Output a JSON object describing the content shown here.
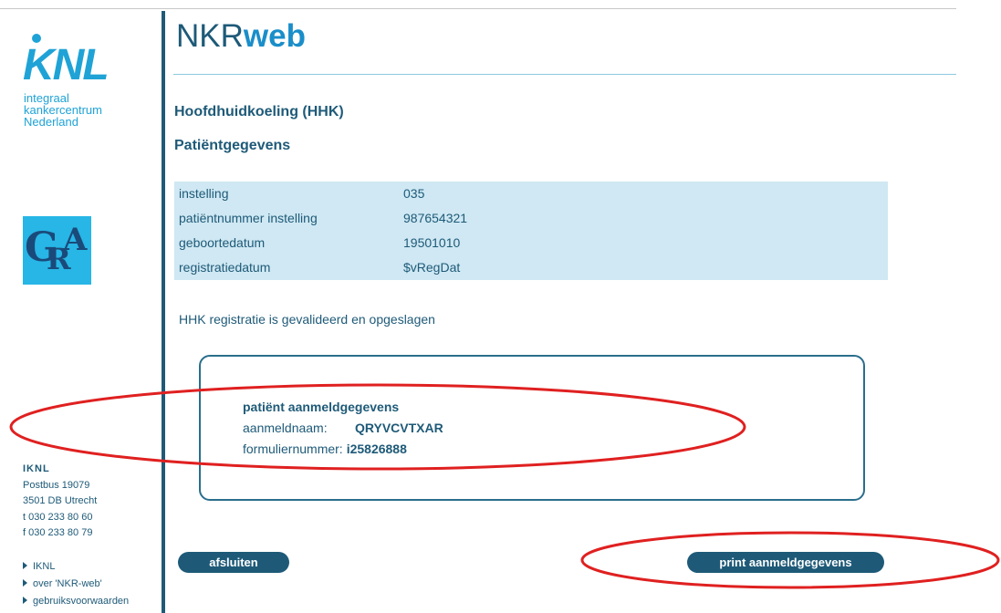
{
  "sidebar": {
    "logo_word": "KNL",
    "logo_sub": [
      "integraal",
      "kankercentrum",
      "Nederland"
    ],
    "badge": {
      "g": "G",
      "r": "R",
      "a": "A"
    },
    "address": {
      "org": "IKNL",
      "line1": "Postbus 19079",
      "line2": "3501 DB Utrecht",
      "phone": "t 030 233 80 60",
      "fax": "f 030 233 80 79"
    },
    "links": [
      "IKNL",
      "over 'NKR-web'",
      "gebruiksvoorwaarden"
    ]
  },
  "header": {
    "title_a": "NKR",
    "title_b": "web"
  },
  "page": {
    "heading": "Hoofdhuidkoeling (HHK)",
    "subheading": "Patiëntgegevens",
    "patient": [
      {
        "label": "instelling",
        "value": "035"
      },
      {
        "label": "patiëntnummer instelling",
        "value": "987654321"
      },
      {
        "label": "geboortedatum",
        "value": "19501010"
      },
      {
        "label": "registratiedatum",
        "value": "$vRegDat"
      }
    ],
    "status_message": "HHK registratie is gevalideerd en opgeslagen",
    "credentials": {
      "title": "patiënt aanmeldgegevens",
      "login_label": "aanmeldnaam:",
      "login_value": "QRYVCVTXAR",
      "form_label": "formuliernummer:",
      "form_value": "i25826888"
    },
    "buttons": {
      "close": "afsluiten",
      "print": "print aanmeldgegevens"
    }
  },
  "colors": {
    "primary": "#1e5a78",
    "accent": "#1fa3d6",
    "table_bg": "#cfe8f3",
    "annotation": "#e02020"
  }
}
